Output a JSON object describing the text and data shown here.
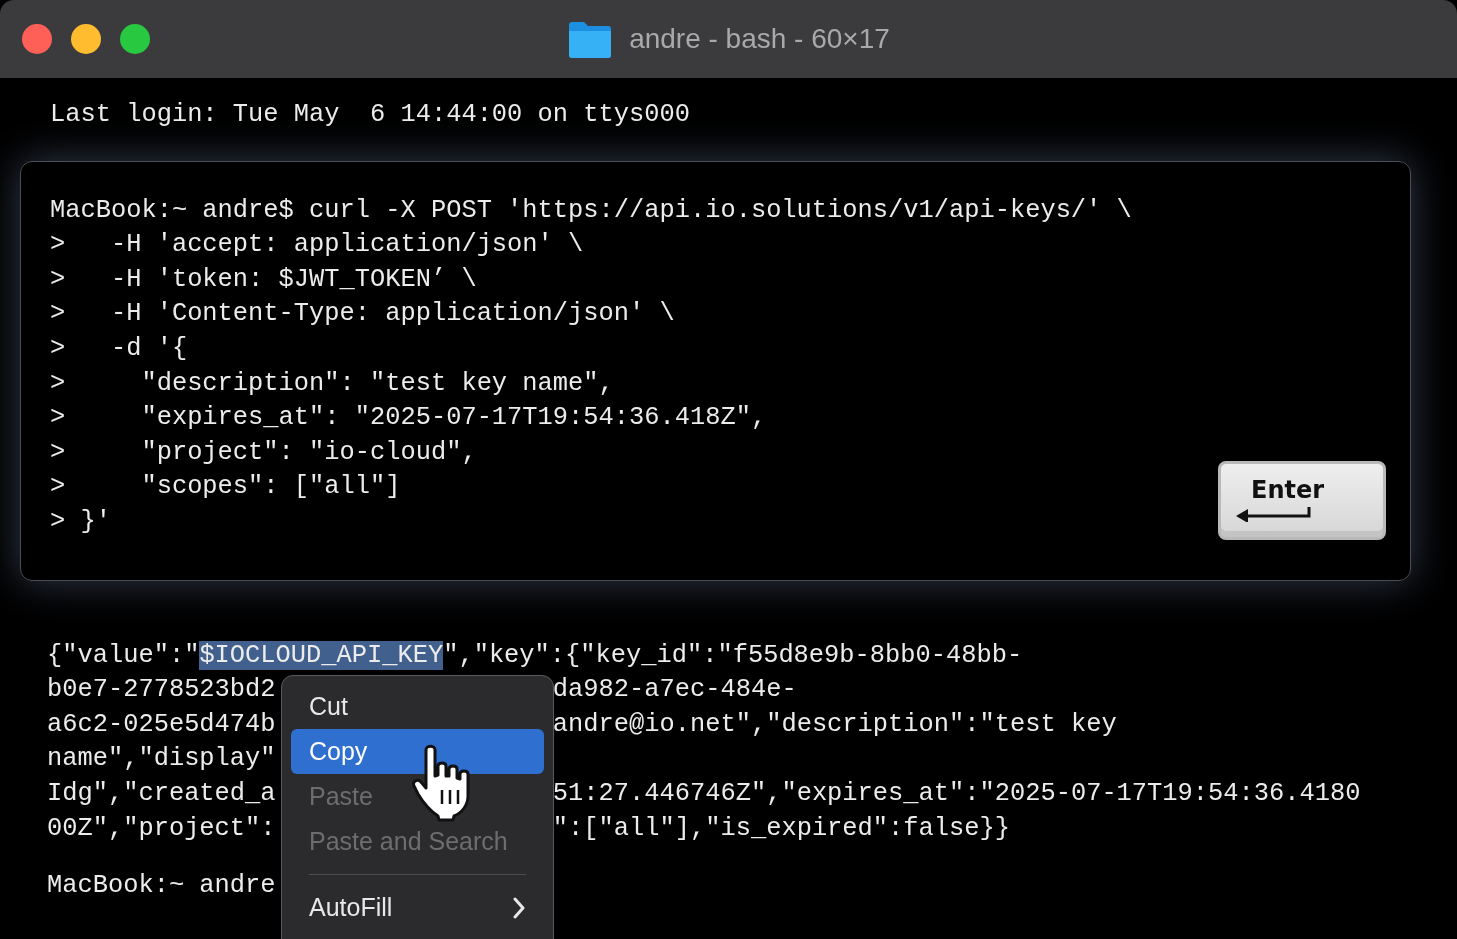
{
  "window": {
    "title": "andre - bash - 60×17"
  },
  "login_line": "Last login: Tue May  6 14:44:00 on ttys000",
  "command_lines": [
    "MacBook:~ andre$ curl -X POST 'https://api.io.solutions/v1/api-keys/' \\",
    ">   -H 'accept: application/json' \\",
    ">   -H 'token: $JWT_TOKEN’ \\",
    ">   -H 'Content-Type: application/json' \\",
    ">   -d '{",
    ">     \"description\": \"test key name\",",
    ">     \"expires_at\": \"2025-07-17T19:54:36.418Z\",",
    ">     \"project\": \"io-cloud\",",
    ">     \"scopes\": [\"all\"]",
    "> }'"
  ],
  "enter_key": {
    "label": "Enter"
  },
  "output_lines": [
    {
      "kind": "full",
      "segments": [
        {
          "text": "{\"value\":\"",
          "selected": false
        },
        {
          "text": "$IOCLOUD_API_KEY",
          "selected": true
        },
        {
          "text": "\",\"key\":{\"key_id\":\"f55d8e9b-8bb0-48bb-",
          "selected": false
        }
      ]
    },
    {
      "kind": "split",
      "left": "b0e7-2778523bd2",
      "right": "da982-a7ec-484e-"
    },
    {
      "kind": "split",
      "left": "a6c2-025e5d474b",
      "right": "andre@io.net\",\"description\":\"test key"
    },
    {
      "kind": "split",
      "left": "name\",\"display\""
    },
    {
      "kind": "split",
      "left": "Idg\",\"created_a",
      "right": "51:27.446746Z\",\"expires_at\":\"2025-07-17T19:54:36.4180"
    },
    {
      "kind": "split",
      "left": "00Z\",\"project\":",
      "right": "\":[\"all\"],\"is_expired\":false}}"
    },
    {
      "kind": "gap"
    },
    {
      "kind": "split",
      "left": "MacBook:~ andre"
    }
  ],
  "context_menu": {
    "items": [
      {
        "kind": "item",
        "label": "Cut",
        "selected": false,
        "disabled": false
      },
      {
        "kind": "item",
        "label": "Copy",
        "selected": true,
        "disabled": false
      },
      {
        "kind": "item",
        "label": "Paste",
        "selected": false,
        "disabled": true
      },
      {
        "kind": "item",
        "label": "Paste and Search",
        "selected": false,
        "disabled": true
      },
      {
        "kind": "separator"
      },
      {
        "kind": "item",
        "label": "AutoFill",
        "selected": false,
        "disabled": false,
        "has_submenu": true
      }
    ]
  }
}
